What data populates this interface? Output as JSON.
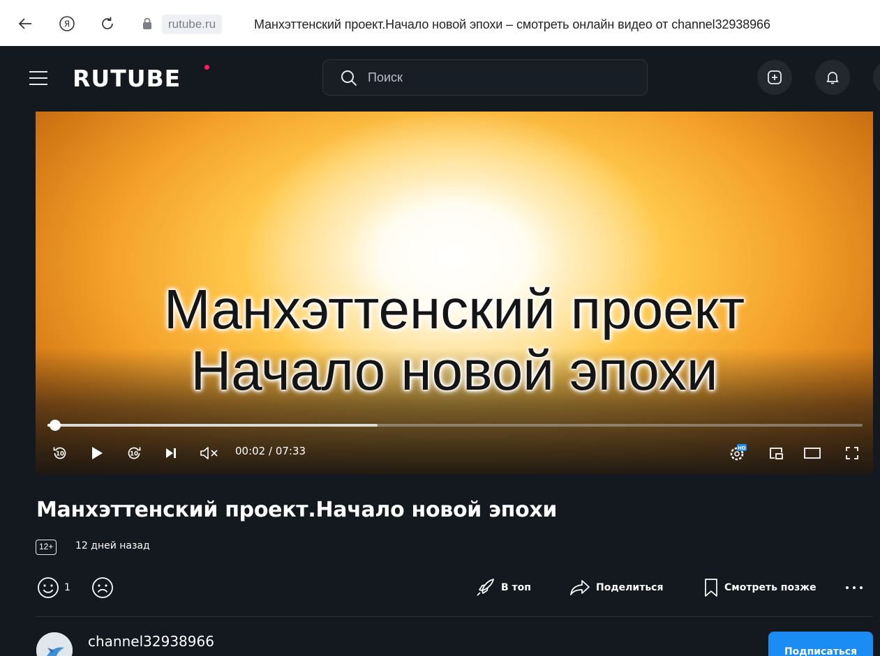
{
  "browser": {
    "url": "rutube.ru",
    "tab_title": "Манхэттенский проект.Начало новой эпохи – смотреть онлайн видео от channel32938966"
  },
  "header": {
    "logo": "RUTUBE",
    "search_placeholder": "Поиск",
    "colors": {
      "background": "#14191f",
      "logo_dot": "#ff1e55"
    }
  },
  "player": {
    "overlay_line1": "Манхэттенский проект",
    "overlay_line2": "Начало новой эпохи",
    "current_time": "00:02",
    "duration": "07:33",
    "played_fraction": 0.004,
    "buffered_fraction": 0.405,
    "controls": [
      "rewind-10-icon",
      "play-icon",
      "forward-10-icon",
      "next-icon",
      "mute-icon",
      "quality-hd-icon",
      "miniplayer-icon",
      "theater-icon",
      "fullscreen-icon"
    ]
  },
  "video": {
    "title": "Манхэттенский проект.Начало новой эпохи",
    "age_rating": "12+",
    "published": "12 дней назад",
    "likes": "1",
    "actions": {
      "top": "В топ",
      "share": "Поделиться",
      "watch_later": "Смотреть позже"
    }
  },
  "channel": {
    "name": "channel32938966",
    "subscribe": "Подписаться",
    "accent": "#1c8cf5"
  }
}
